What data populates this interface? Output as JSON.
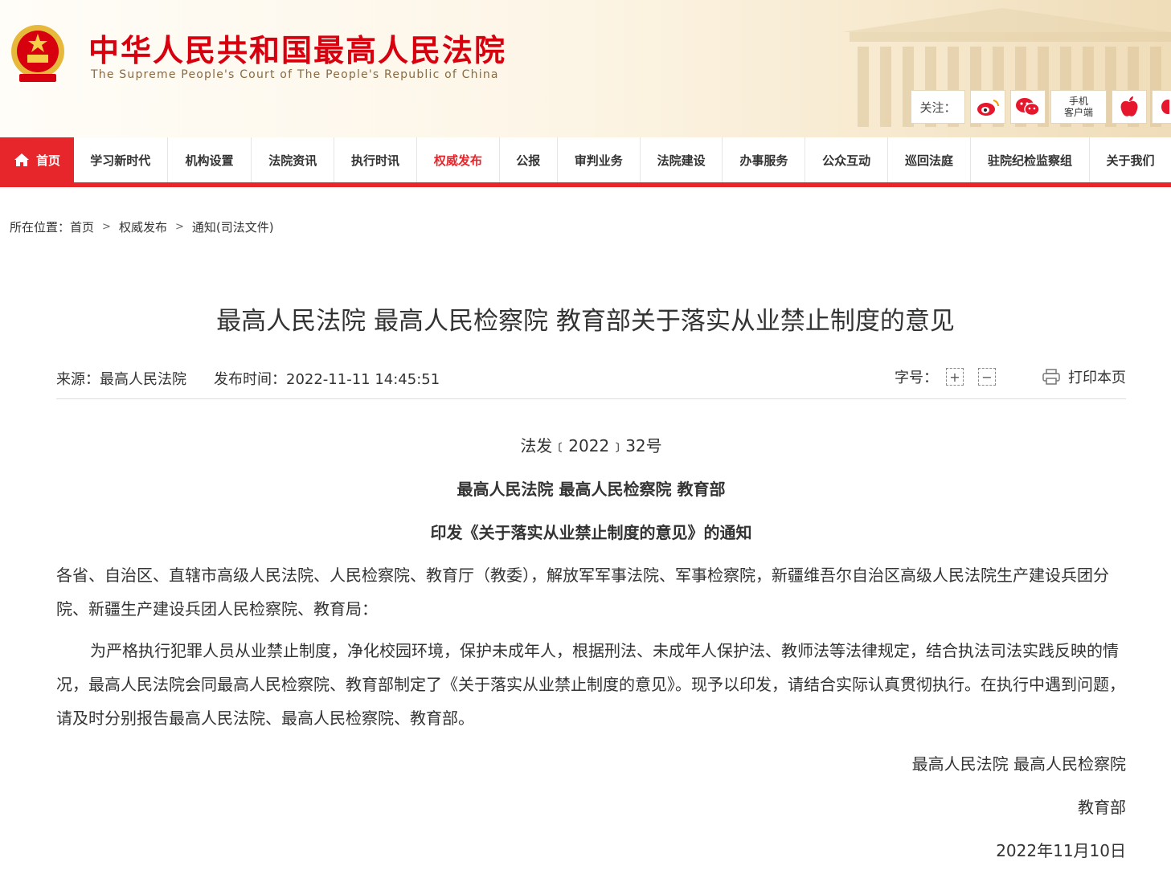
{
  "header": {
    "site_title": "中华人民共和国最高人民法院",
    "site_subtitle": "The Supreme People's Court of The People's Republic of China",
    "follow_label": "关注：",
    "follow_icons": [
      "weibo-icon",
      "wechat-icon",
      "mobile-client",
      "apple-icon"
    ],
    "mobile_client_line1": "手机",
    "mobile_client_line2": "客户端"
  },
  "nav": {
    "items": [
      {
        "label": "首页",
        "active": true
      },
      {
        "label": "学习新时代"
      },
      {
        "label": "机构设置"
      },
      {
        "label": "法院资讯"
      },
      {
        "label": "执行时讯"
      },
      {
        "label": "权威发布",
        "current": true
      },
      {
        "label": "公报"
      },
      {
        "label": "审判业务"
      },
      {
        "label": "法院建设"
      },
      {
        "label": "办事服务"
      },
      {
        "label": "公众互动"
      },
      {
        "label": "巡回法庭"
      },
      {
        "label": "驻院纪检监察组"
      },
      {
        "label": "关于我们"
      }
    ]
  },
  "breadcrumb": {
    "prefix": "所在位置：",
    "items": [
      "首页",
      "权威发布",
      "通知(司法文件)"
    ]
  },
  "article": {
    "title": "最高人民法院 最高人民检察院 教育部关于落实从业禁止制度的意见",
    "source": "来源：最高人民法院",
    "publish_time": "发布时间：2022-11-11 14:45:51",
    "font_size_label": "字号：",
    "font_increase": "+",
    "font_decrease": "−",
    "print_label": "打印本页",
    "doc_number": "法发﹝2022﹞32号",
    "issuers": "最高人民法院 最高人民检察院 教育部",
    "notice_title": "印发《关于落实从业禁止制度的意见》的通知",
    "addressee": "各省、自治区、直辖市高级人民法院、人民检察院、教育厅（教委），解放军军事法院、军事检察院，新疆维吾尔自治区高级人民法院生产建设兵团分院、新疆生产建设兵团人民检察院、教育局：",
    "paragraph": "为严格执行犯罪人员从业禁止制度，净化校园环境，保护未成年人，根据刑法、未成年人保护法、教师法等法律规定，结合执法司法实践反映的情况，最高人民法院会同最高人民检察院、教育部制定了《关于落实从业禁止制度的意见》。现予以印发，请结合实际认真贯彻执行。在执行中遇到问题，请及时分别报告最高人民法院、最高人民检察院、教育部。",
    "signature_line1": "最高人民法院 最高人民检察院",
    "signature_line2": "教育部",
    "signature_date": "2022年11月10日"
  },
  "colors": {
    "brand_red": "#e7262b",
    "title_red": "#d7000f"
  }
}
